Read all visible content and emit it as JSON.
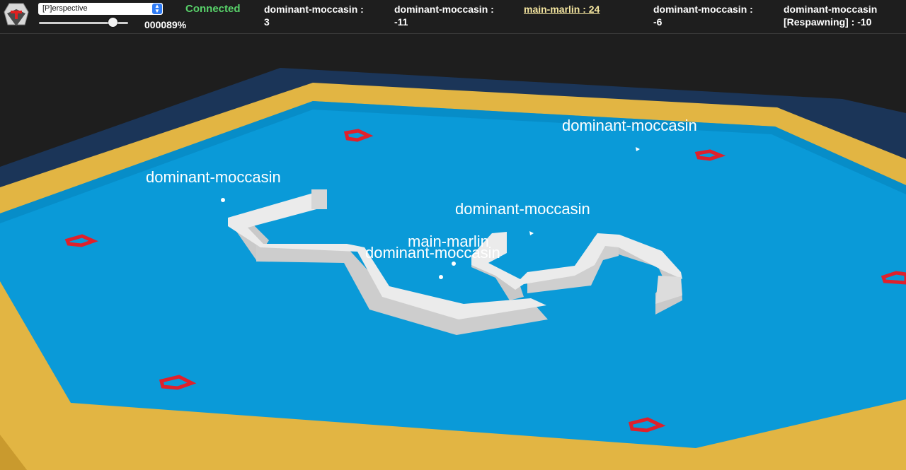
{
  "hud": {
    "camera_mode": "[P]erspective",
    "zoom_percent": "000089%",
    "zoom_level": 0.82,
    "connection_status": "Connected",
    "scores": [
      {
        "text": "dominant-moccasin :\n3"
      },
      {
        "text": "dominant-moccasin :\n-11"
      },
      {
        "text": "main-marlin : 24"
      },
      {
        "text": "dominant-moccasin :\n-6"
      },
      {
        "text": "dominant-moccasin\n[Respawning] : -10"
      }
    ]
  },
  "arena": {
    "player_labels": [
      "dominant-moccasin",
      "dominant-moccasin",
      "dominant-moccasin",
      "main-marlin",
      "dominant-moccasin"
    ],
    "colors": {
      "background": "#1e1e1e",
      "outer_floor": "#1b3558",
      "wall_top": "#e2b543",
      "wall_side": "#c99a2e",
      "water": "#0a9ad8",
      "obstacle": "#e0e0e0",
      "spawn_marker": "#e0202b"
    },
    "icons": [
      "tank-logo-icon",
      "spawn-pentagon-icon",
      "player-bullet-icon"
    ]
  }
}
